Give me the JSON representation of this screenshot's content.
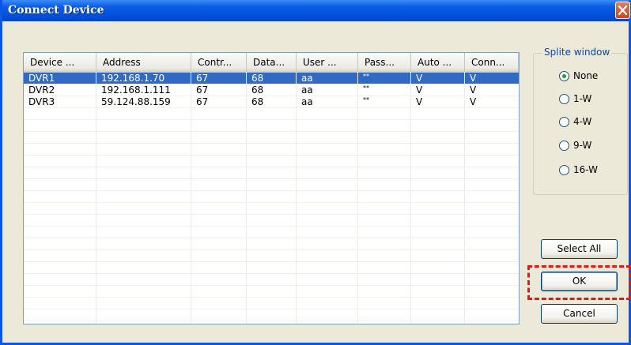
{
  "window": {
    "title": "Connect Device"
  },
  "list": {
    "columns": [
      "Device ...",
      "Address",
      "Contr...",
      "Data...",
      "User ...",
      "Pass...",
      "Auto ...",
      "Conn..."
    ],
    "rows": [
      [
        "DVR1",
        "192.168.1.70",
        "67",
        "68",
        "aa",
        "**",
        "V",
        "V"
      ],
      [
        "DVR2",
        "192.168.1.111",
        "67",
        "68",
        "aa",
        "**",
        "V",
        "V"
      ],
      [
        "DVR3",
        "59.124.88.159",
        "67",
        "68",
        "aa",
        "**",
        "V",
        "V"
      ]
    ],
    "selected_row": 0
  },
  "split_window": {
    "title": "Splite window",
    "options": [
      "None",
      "1-W",
      "4-W",
      "9-W",
      "16-W"
    ],
    "selected": "None"
  },
  "buttons": {
    "select_all": "Select All",
    "ok": "OK",
    "cancel": "Cancel"
  },
  "colors": {
    "title_bar": "#0A58E2",
    "selection": "#316AC5",
    "highlight_box": "#E0171B"
  }
}
